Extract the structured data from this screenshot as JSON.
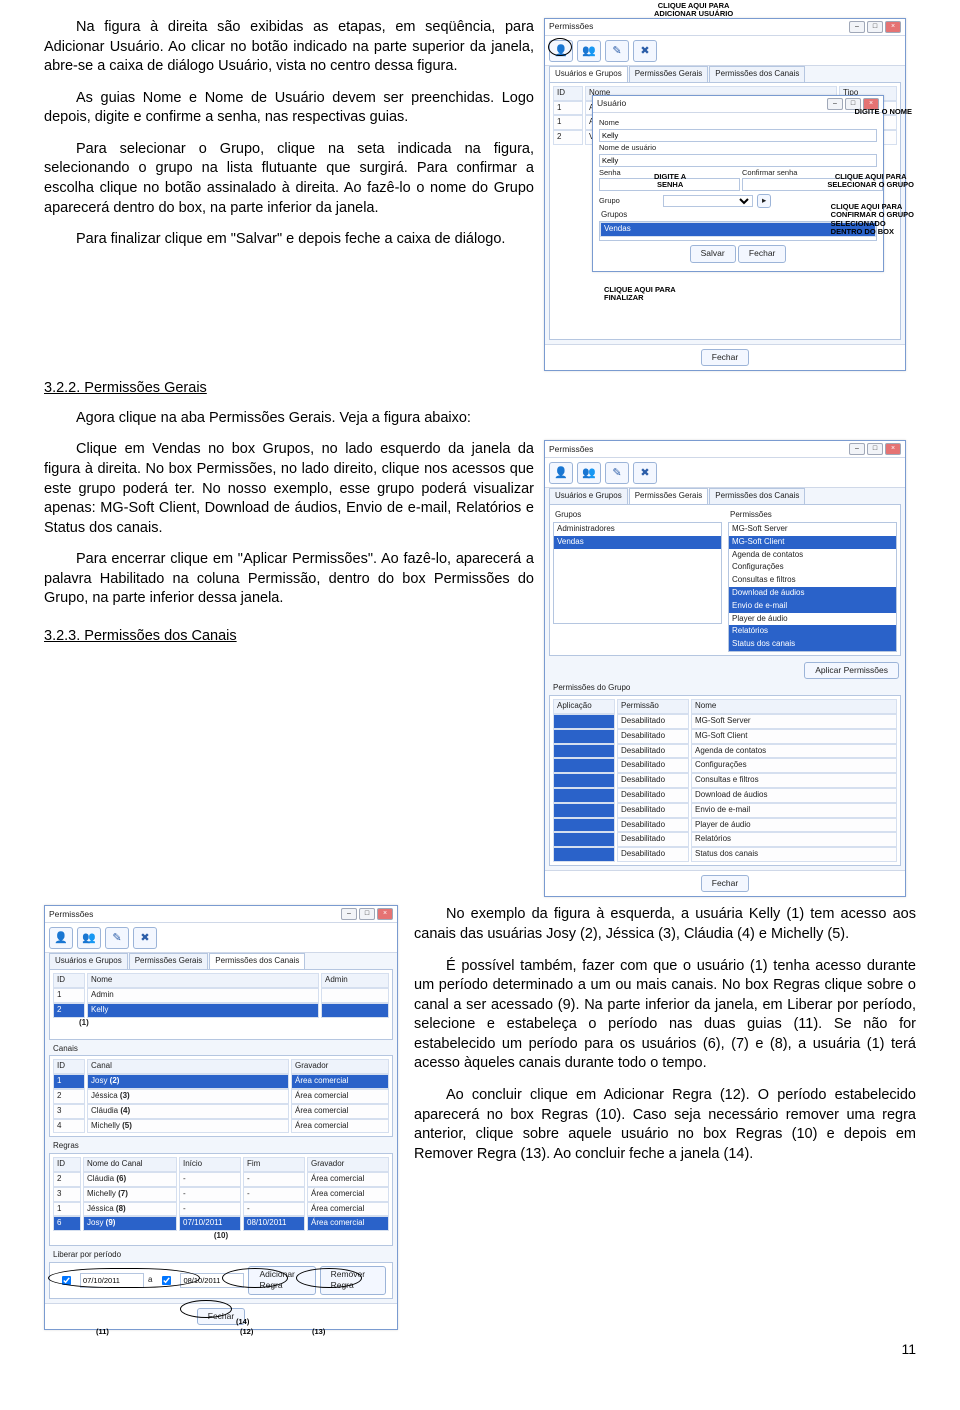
{
  "paras": {
    "p1": "Na figura à direita são exibidas as etapas, em seqüência, para Adicionar Usuário. Ao clicar no botão indicado na parte superior da janela, abre-se a caixa de diálogo Usuário, vista no centro dessa figura.",
    "p2": "As guias Nome e Nome de Usuário devem ser preenchidas. Logo depois, digite e confirme a senha, nas respectivas guias.",
    "p3": "Para selecionar o Grupo, clique na seta indicada na figura, selecionando o grupo na lista flutuante que surgirá. Para confirmar a escolha clique no botão assinalado à direita. Ao fazê-lo o nome do Grupo aparecerá dentro do box, na parte inferior da janela.",
    "p4": "Para finalizar clique em \"Salvar\" e depois feche a caixa de diálogo.",
    "h322": "3.2.2. Permissões Gerais",
    "p5": "Agora clique na aba Permissões Gerais. Veja a figura abaixo:",
    "p6": "Clique em Vendas no box Grupos, no lado esquerdo da janela da figura à direita. No box Permissões, no lado direito, clique nos acessos que este grupo poderá ter. No nosso exemplo, esse grupo poderá visualizar apenas: MG-Soft Client, Download de áudios, Envio de e-mail, Relatórios e Status dos canais.",
    "p7": "Para encerrar clique em \"Aplicar Permissões\". Ao fazê-lo, aparecerá a palavra Habilitado na coluna Permissão, dentro do box Permissões do Grupo, na parte inferior dessa janela.",
    "h323": "3.2.3. Permissões dos Canais",
    "p8": "No exemplo da figura à esquerda, a usuária Kelly (1) tem acesso aos canais das usuárias Josy (2), Jéssica (3), Cláudia (4) e Michelly (5).",
    "p9": "É possível também, fazer com que o usuário (1) tenha acesso durante um período determinado a um ou mais canais. No box Regras clique sobre o canal a ser acessado (9). Na parte inferior da janela, em Liberar por período, selecione e estabeleça o período nas duas guias (11). Se não for estabelecido um período para os usuários (6), (7) e (8), a usuária (1) terá acesso àqueles canais durante todo o tempo.",
    "p10": "Ao concluir clique em Adicionar Regra (12). O período estabelecido aparecerá no box Regras (10). Caso seja necessário remover uma regra anterior, clique sobre aquele usuário no box Regras (10) e depois em Remover Regra (13). Ao concluir feche a janela (14)."
  },
  "page_number": "11",
  "figA": {
    "title": "Permissões",
    "callout_top": "CLIQUE AQUI PARA\nADICIONAR USUÁRIO",
    "tabs": [
      "Usuários e Grupos",
      "Permissões Gerais",
      "Permissões dos Canais"
    ],
    "columns": [
      "ID",
      "Nome",
      "Tipo"
    ],
    "rows": [
      [
        "1",
        "Admin",
        ""
      ],
      [
        "1",
        "Administradores",
        ""
      ],
      [
        "2",
        "Vendas",
        ""
      ]
    ],
    "user_dlg": {
      "title": "Usuário",
      "fields": {
        "nome": "Nome",
        "nome_val": "Kelly",
        "nomeuser": "Nome de usuário",
        "nomeuser_val": "Kelly",
        "senha": "Senha",
        "conf": "Confirmar senha",
        "grupo": "Grupo",
        "grupos": "Grupos",
        "grupo_val": "Vendas"
      },
      "buttons": {
        "salvar": "Salvar",
        "fechar": "Fechar"
      }
    },
    "callouts": {
      "nome": "DIGITE O NOME",
      "senha": "DIGITE A\nSENHA",
      "sel_grupo": "CLIQUE AQUI PARA\nSELECIONAR O GRUPO",
      "conf_grupo": "CLIQUE AQUI PARA\nCONFIRMAR O GRUPO\nSELECIONADO\nDENTRO DO BOX",
      "finalizar": "CLIQUE AQUI PARA\nFINALIZAR"
    },
    "bottom_btn": "Fechar"
  },
  "figB": {
    "title": "Permissões",
    "tabs": [
      "Usuários e Grupos",
      "Permissões Gerais",
      "Permissões dos Canais"
    ],
    "groups_label": "Grupos",
    "groups": [
      "Administradores",
      "Vendas"
    ],
    "perm_label": "Permissões",
    "perms": [
      "MG-Soft Server",
      "MG-Soft Client",
      "Agenda de contatos",
      "Configurações",
      "Consultas e filtros",
      "Download de áudios",
      "Envio de e-mail",
      "Player de áudio",
      "Relatórios",
      "Status dos canais"
    ],
    "perm_selected_idx": [
      1,
      5,
      6,
      8,
      9
    ],
    "apply_btn": "Aplicar Permissões",
    "pg_label": "Permissões do Grupo",
    "pg_cols": [
      "Aplicação",
      "Permissão",
      "Nome"
    ],
    "pg_rows": [
      [
        "",
        "Desabilitado",
        "MG-Soft Server"
      ],
      [
        "",
        "Desabilitado",
        "MG-Soft Client"
      ],
      [
        "",
        "Desabilitado",
        "Agenda de contatos"
      ],
      [
        "",
        "Desabilitado",
        "Configurações"
      ],
      [
        "",
        "Desabilitado",
        "Consultas e filtros"
      ],
      [
        "",
        "Desabilitado",
        "Download de áudios"
      ],
      [
        "",
        "Desabilitado",
        "Envio de e-mail"
      ],
      [
        "",
        "Desabilitado",
        "Player de áudio"
      ],
      [
        "",
        "Desabilitado",
        "Relatórios"
      ],
      [
        "",
        "Desabilitado",
        "Status dos canais"
      ]
    ],
    "bottom_btn": "Fechar"
  },
  "figC": {
    "title": "Permissões",
    "tabs": [
      "Usuários e Grupos",
      "Permissões Gerais",
      "Permissões dos Canais"
    ],
    "users_cols": [
      "ID",
      "Nome",
      "Admin"
    ],
    "users": [
      [
        "1",
        "Admin",
        ""
      ],
      [
        "2",
        "Kelly",
        ""
      ]
    ],
    "marker1": "(1)",
    "canais_label": "Canais",
    "canais_cols": [
      "ID",
      "Canal",
      "Gravador"
    ],
    "canais": [
      [
        "1",
        "Josy",
        "Área comercial"
      ],
      [
        "2",
        "Jéssica",
        "Área comercial"
      ],
      [
        "3",
        "Cláudia",
        "Área comercial"
      ],
      [
        "4",
        "Michelly",
        "Área comercial"
      ]
    ],
    "canais_markers": [
      "(2)",
      "(3)",
      "(4)",
      "(5)"
    ],
    "regras_label": "Regras",
    "regras_cols": [
      "ID",
      "Nome do Canal",
      "Início",
      "Fim",
      "Gravador"
    ],
    "regras": [
      [
        "2",
        "Cláudia",
        "-",
        "-",
        "Área comercial"
      ],
      [
        "3",
        "Michelly",
        "-",
        "-",
        "Área comercial"
      ],
      [
        "1",
        "Jéssica",
        "-",
        "-",
        "Área comercial"
      ],
      [
        "6",
        "Josy",
        "07/10/2011",
        "08/10/2011",
        "Área comercial"
      ]
    ],
    "regras_markers": [
      "(6)",
      "(7)",
      "(8)",
      "(9)"
    ],
    "marker10": "(10)",
    "liberar_label": "Liberar por período",
    "date1": "07/10/2011",
    "date2": "08/10/2011",
    "btn_add": "Adicionar Regra",
    "btn_rem": "Remover Regra",
    "bottom_btn": "Fechar",
    "markers_bottom": {
      "m11": "(11)",
      "m12": "(12)",
      "m13": "(13)",
      "m14": "(14)"
    }
  }
}
